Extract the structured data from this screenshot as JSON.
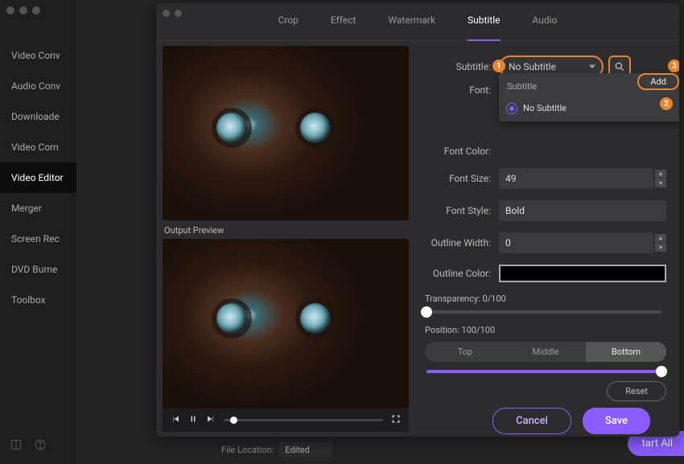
{
  "sidebar": {
    "items": [
      {
        "label": "Video Conv"
      },
      {
        "label": "Audio Conv"
      },
      {
        "label": "Downloade"
      },
      {
        "label": "Video Com"
      },
      {
        "label": "Video Editor"
      },
      {
        "label": "Merger"
      },
      {
        "label": "Screen Rec"
      },
      {
        "label": "DVD Burne"
      },
      {
        "label": "Toolbox"
      }
    ],
    "active_index": 4
  },
  "tabs": {
    "items": [
      "Crop",
      "Effect",
      "Watermark",
      "Subtitle",
      "Audio"
    ],
    "active_index": 3
  },
  "preview": {
    "output_label": "Output Preview"
  },
  "subtitle_panel": {
    "subtitle_label": "Subtitle:",
    "subtitle_value": "No Subtitle",
    "search_icon": "search-icon",
    "dropdown": {
      "header": "Subtitle",
      "options": [
        "No Subtitle"
      ],
      "selected_index": 0,
      "add_label": "Add"
    },
    "font_label": "Font:",
    "font_color_label": "Font Color:",
    "font_size_label": "Font Size:",
    "font_size_value": "49",
    "font_style_label": "Font Style:",
    "font_style_value": "Bold",
    "outline_width_label": "Outline Width:",
    "outline_width_value": "0",
    "outline_color_label": "Outline Color:",
    "outline_color_value": "#000000",
    "transparency_label": "Transparency: 0/100",
    "transparency_value": 0,
    "position_label": "Position: 100/100",
    "position_value": 100,
    "position_buttons": [
      "Top",
      "Middle",
      "Bottom"
    ],
    "position_active_index": 2,
    "reset_label": "Reset",
    "markers": {
      "m1": "1",
      "m2": "2",
      "m3": "3"
    }
  },
  "footer": {
    "cancel": "Cancel",
    "save": "Save"
  },
  "main_bg": {
    "file_location_label": "File Location:",
    "file_location_value": "Edited",
    "start_all": "tart All"
  }
}
